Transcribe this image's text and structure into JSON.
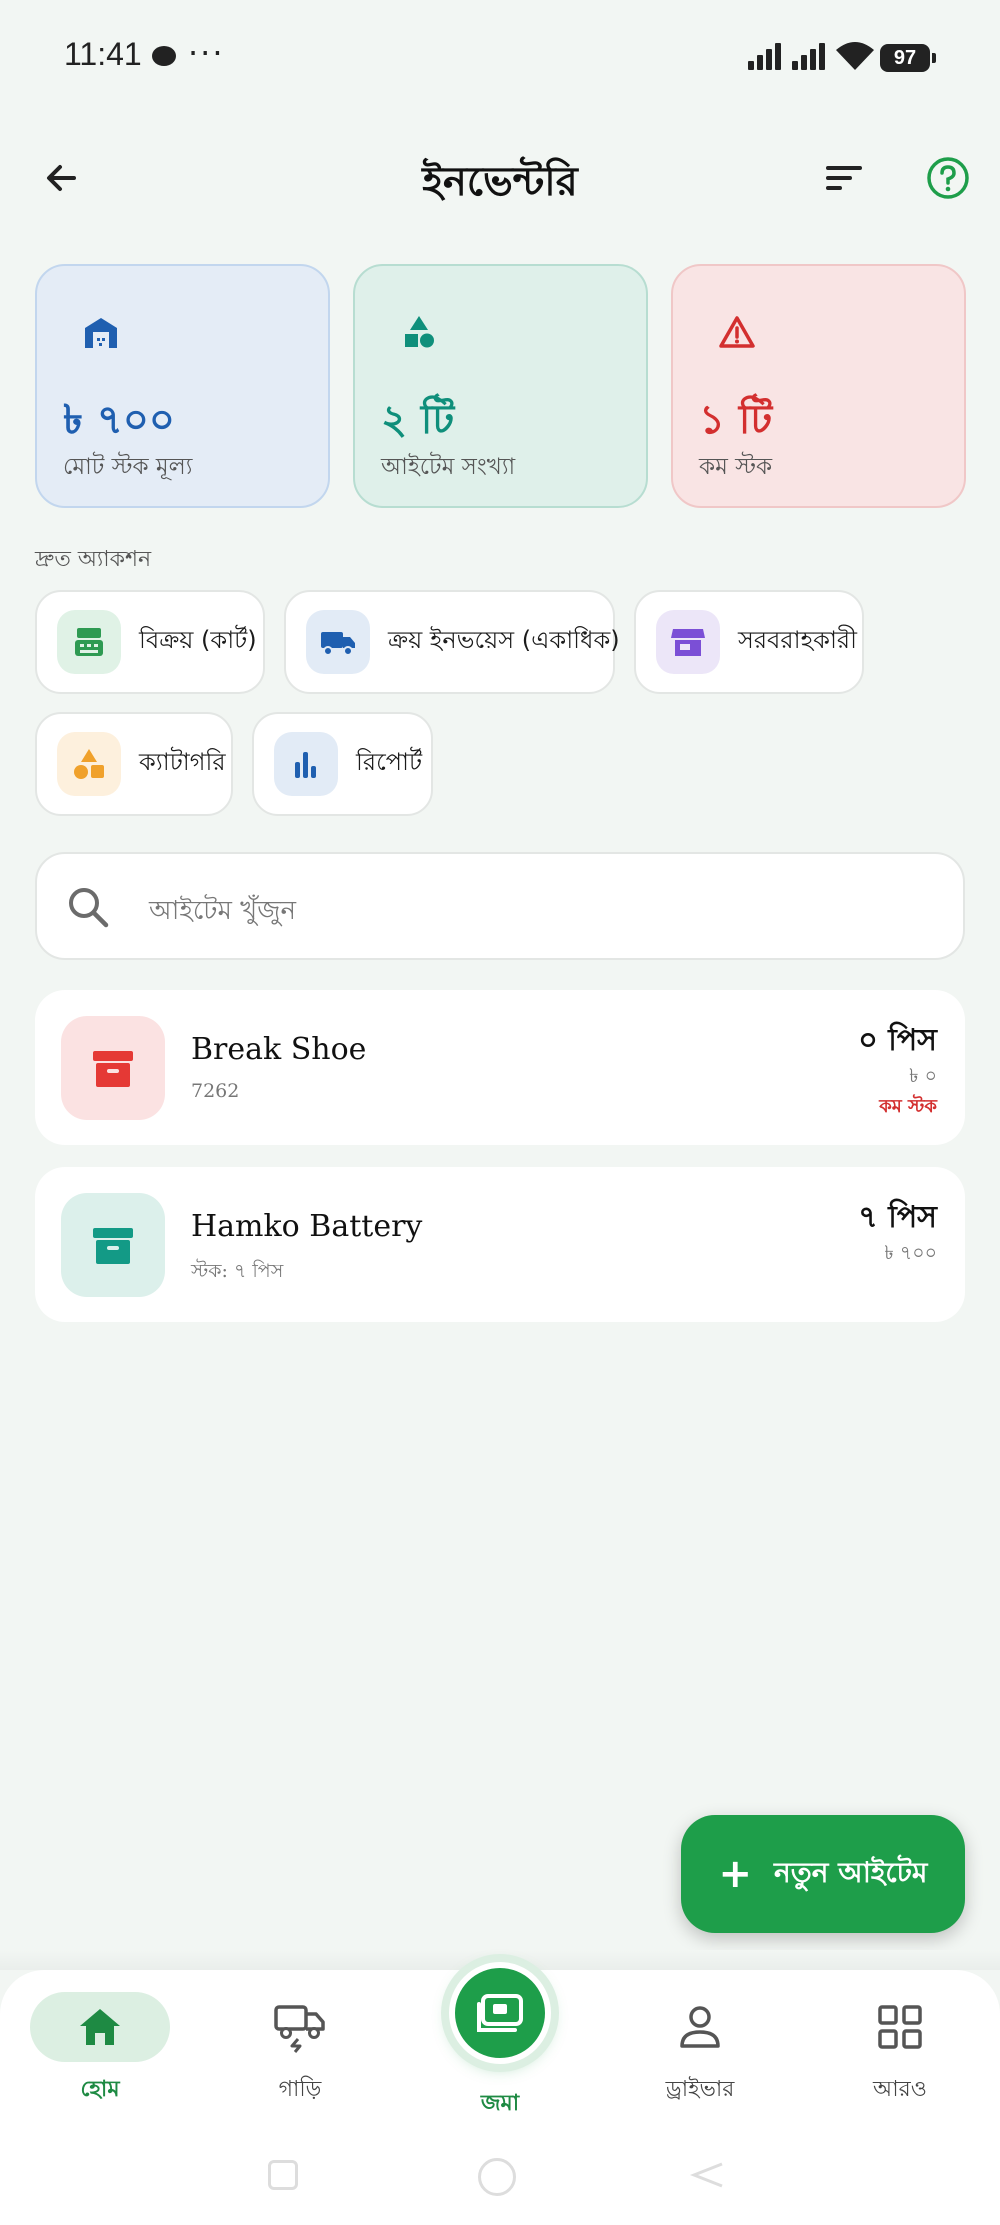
{
  "status_bar": {
    "time": "11:41",
    "dots": "···",
    "battery": "97"
  },
  "header": {
    "title": "ইনভেন্টরি"
  },
  "stats": [
    {
      "value": "৳ ৭০০",
      "label": "মোট স্টক মূল্য",
      "icon": "warehouse-icon",
      "color": "#1f5fb0"
    },
    {
      "value": "২ টি",
      "label": "আইটেম সংখ্যা",
      "icon": "shapes-icon",
      "color": "#0f8f7b"
    },
    {
      "value": "১ টি",
      "label": "কম স্টক",
      "icon": "warning-icon",
      "color": "#d32f2f"
    }
  ],
  "quick_actions": {
    "title": "দ্রুত অ্যাকশন",
    "items": [
      {
        "label": "বিক্রয় (কার্ট)",
        "icon": "cash-register-icon"
      },
      {
        "label": "ক্রয় ইনভয়েস (একাধিক)",
        "icon": "truck-icon"
      },
      {
        "label": "সরবরাহকারী",
        "icon": "store-icon"
      },
      {
        "label": "ক্যাটাগরি",
        "icon": "category-icon"
      },
      {
        "label": "রিপোর্ট",
        "icon": "bar-chart-icon"
      }
    ]
  },
  "search": {
    "placeholder": "আইটেম খুঁজুন"
  },
  "items": [
    {
      "name": "Break Shoe",
      "sub": "7262",
      "qty": "০ পিস",
      "price": "৳ ০",
      "badge": "কম স্টক",
      "color": "#e53935"
    },
    {
      "name": "Hamko Battery",
      "sub": "স্টক: ৭ পিস",
      "qty": "৭ পিস",
      "price": "৳ ৭০০",
      "color": "#139a86"
    }
  ],
  "fab": {
    "plus": "+",
    "label": "নতুন আইটেম"
  },
  "bottom_nav": [
    {
      "label": "হোম",
      "icon": "home-icon",
      "active": true
    },
    {
      "label": "গাড়ি",
      "icon": "truck-icon"
    },
    {
      "label": "জমা",
      "icon": "cash-icon"
    },
    {
      "label": "ড্রাইভার",
      "icon": "person-icon"
    },
    {
      "label": "আরও",
      "icon": "grid-icon"
    }
  ],
  "colors": {
    "accent": "#1e9e4a",
    "background": "#f2f6f3"
  }
}
